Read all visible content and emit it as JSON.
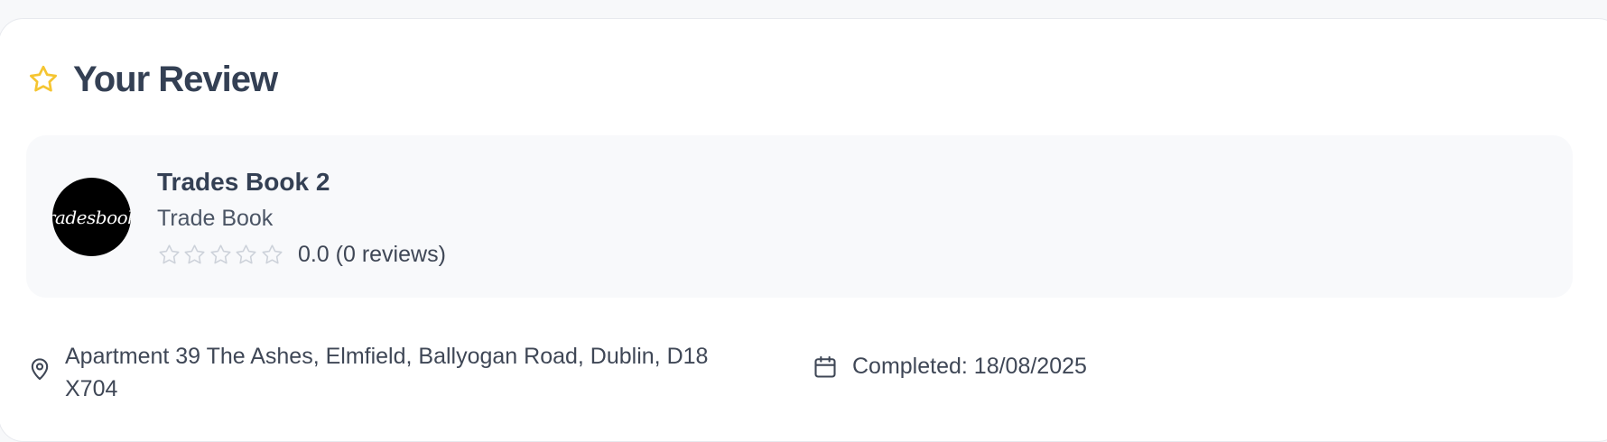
{
  "header": {
    "title": "Your Review",
    "icon": "star-outline-icon",
    "icon_color": "#f5c531"
  },
  "provider": {
    "name": "Trades Book 2",
    "type": "Trade Book",
    "logo_text": "tradesbook.",
    "rating": 0.0,
    "rating_text": "0.0 (0 reviews)",
    "stars_total": 5,
    "stars_filled": 0
  },
  "job": {
    "address": "Apartment 39 The Ashes, Elmfield, Ballyogan Road, Dublin, D18 X704",
    "completed": "Completed: 18/08/2025"
  }
}
